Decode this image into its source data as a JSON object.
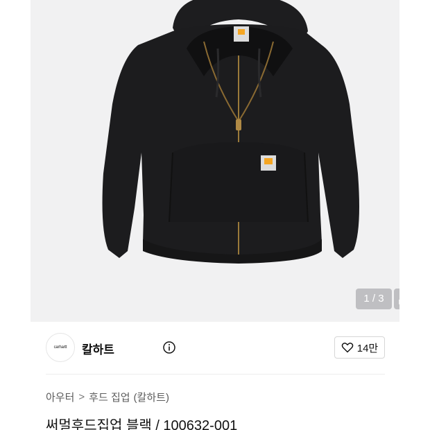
{
  "gallery": {
    "counter": "1 / 3",
    "background": "#f1f1f2"
  },
  "brand": {
    "logo_text": "carhartt",
    "name": "칼하트"
  },
  "like": {
    "count": "14만"
  },
  "breadcrumb": {
    "category": "아우터",
    "separator": ">",
    "subcategory": "후드 집업",
    "brand": "(칼하트)"
  },
  "product": {
    "title": "써멀후드집업 블랙 / 100632-001"
  },
  "colors": {
    "accent": "#f5a623",
    "hoodie": "#1c1c1e"
  }
}
